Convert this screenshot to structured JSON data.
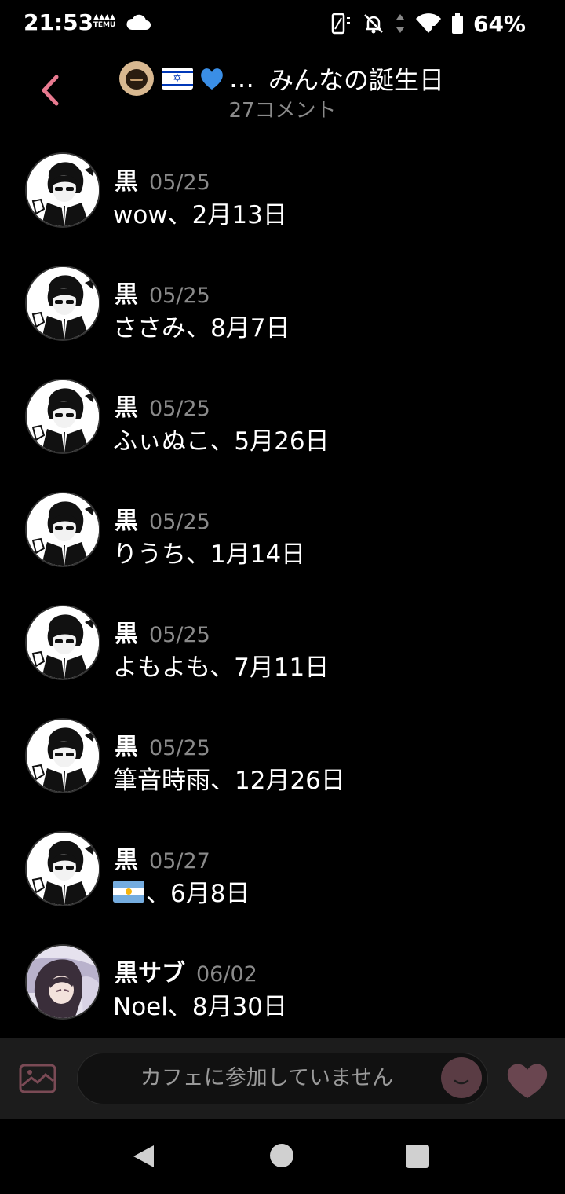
{
  "status_bar": {
    "time": "21:53",
    "temu_label": "TEMU",
    "battery": "64%"
  },
  "header": {
    "title": "みんなの誕生日",
    "ellipsis": "…",
    "subtitle": "27コメント"
  },
  "comments": [
    {
      "author": "黒",
      "date": "05/25",
      "text": "wow、2月13日",
      "avatar": "monochrome-anime-avatar"
    },
    {
      "author": "黒",
      "date": "05/25",
      "text": "ささみ、8月7日",
      "avatar": "monochrome-anime-avatar"
    },
    {
      "author": "黒",
      "date": "05/25",
      "text": "ふぃぬこ、5月26日",
      "avatar": "monochrome-anime-avatar"
    },
    {
      "author": "黒",
      "date": "05/25",
      "text": "りうち、1月14日",
      "avatar": "monochrome-anime-avatar"
    },
    {
      "author": "黒",
      "date": "05/25",
      "text": "よもよも、7月11日",
      "avatar": "monochrome-anime-avatar"
    },
    {
      "author": "黒",
      "date": "05/25",
      "text": "筆音時雨、12月26日",
      "avatar": "monochrome-anime-avatar"
    },
    {
      "author": "黒",
      "date": "05/27",
      "text": "、6月8日",
      "avatar": "monochrome-anime-avatar",
      "leading_flag": "argentina-flag"
    },
    {
      "author": "黒サブ",
      "date": "06/02",
      "text": "Noel、8月30日",
      "avatar": "color-anime-avatar"
    }
  ],
  "input_bar": {
    "placeholder": "カフェに参加していません"
  },
  "colors": {
    "background": "#000000",
    "accent_pink": "#e87a90",
    "muted_text": "#8a8a8a",
    "input_bar": "#1c1c1c"
  }
}
